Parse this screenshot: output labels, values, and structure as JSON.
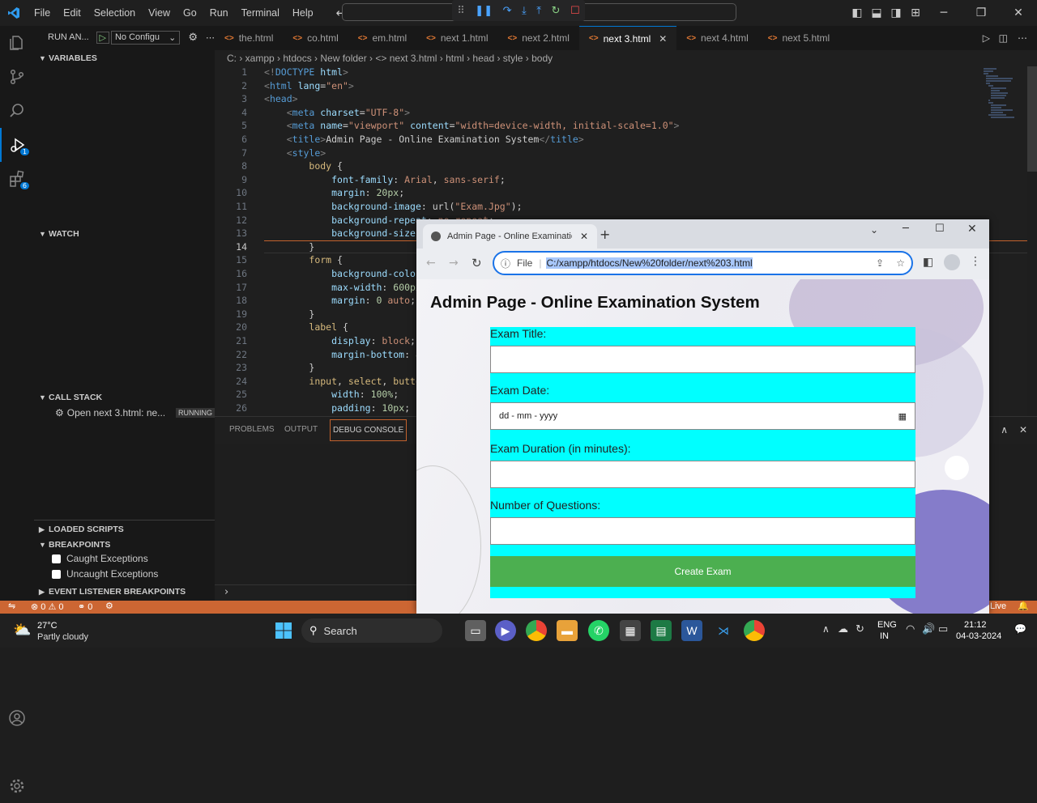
{
  "titlebar": {
    "menu": [
      "File",
      "Edit",
      "Selection",
      "View",
      "Go",
      "Run",
      "Terminal",
      "Help"
    ]
  },
  "sidebar": {
    "run_label": "RUN AN...",
    "config_label": "No Configu",
    "variables": "VARIABLES",
    "watch": "WATCH",
    "call_stack": "CALL STACK",
    "call_stack_item": "Open next 3.html: ne...",
    "running": "RUNNING",
    "loaded_scripts": "LOADED SCRIPTS",
    "breakpoints": "BREAKPOINTS",
    "caught": "Caught Exceptions",
    "uncaught": "Uncaught Exceptions",
    "event_listener": "EVENT LISTENER BREAKPOINTS"
  },
  "tabs": [
    "the.html",
    "co.html",
    "em.html",
    "next 1.html",
    "next 2.html",
    "next 3.html",
    "next 4.html",
    "next 5.html"
  ],
  "active_tab": "next 3.html",
  "breadcrumb": "C: › xampp › htdocs › New folder › <> next 3.html › html › head › style › body",
  "editor": {
    "current_line": 14
  },
  "panel": {
    "problems": "PROBLEMS",
    "output": "OUTPUT",
    "debug_console": "DEBUG CONSOLE"
  },
  "statusbar": {
    "errors": "⊗ 0 ⚠ 0",
    "ports": "⚭ 0",
    "live": "Live"
  },
  "browser": {
    "tab_title": "Admin Page - Online Examination",
    "file_label": "File",
    "url": "C:/xampp/htdocs/New%20folder/next%203.html",
    "page_title": "Admin Page - Online Examination System",
    "labels": [
      "Exam Title:",
      "Exam Date:",
      "Exam Duration (in minutes):",
      "Number of Questions:"
    ],
    "date_placeholder": "dd - mm - yyyy",
    "button": "Create Exam"
  },
  "taskbar": {
    "temp": "27°C",
    "weather": "Partly cloudy",
    "search": "Search",
    "lang1": "ENG",
    "lang2": "IN",
    "time": "21:12",
    "date": "04-03-2024"
  },
  "colors": {
    "statusbar": "#cc6633",
    "form_bg": "#00ffff",
    "button_bg": "#4caf50",
    "accent": "#0078d4"
  }
}
